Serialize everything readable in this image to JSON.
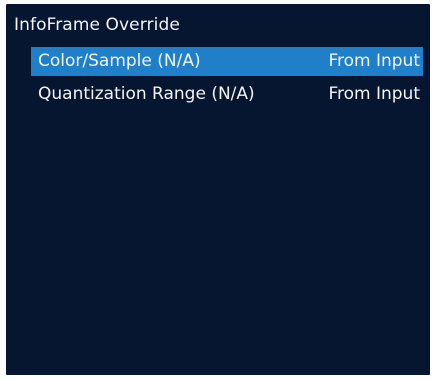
{
  "header": {
    "title": "InfoFrame Override"
  },
  "menu": {
    "items": [
      {
        "label": "Color/Sample (N/A)",
        "value": "From Input",
        "selected": true
      },
      {
        "label": "Quantization Range (N/A)",
        "value": "From Input",
        "selected": false
      }
    ]
  },
  "colors": {
    "panel_background": "#061530",
    "selection_highlight": "#1f7fc8",
    "text": "#f2f4f8"
  }
}
